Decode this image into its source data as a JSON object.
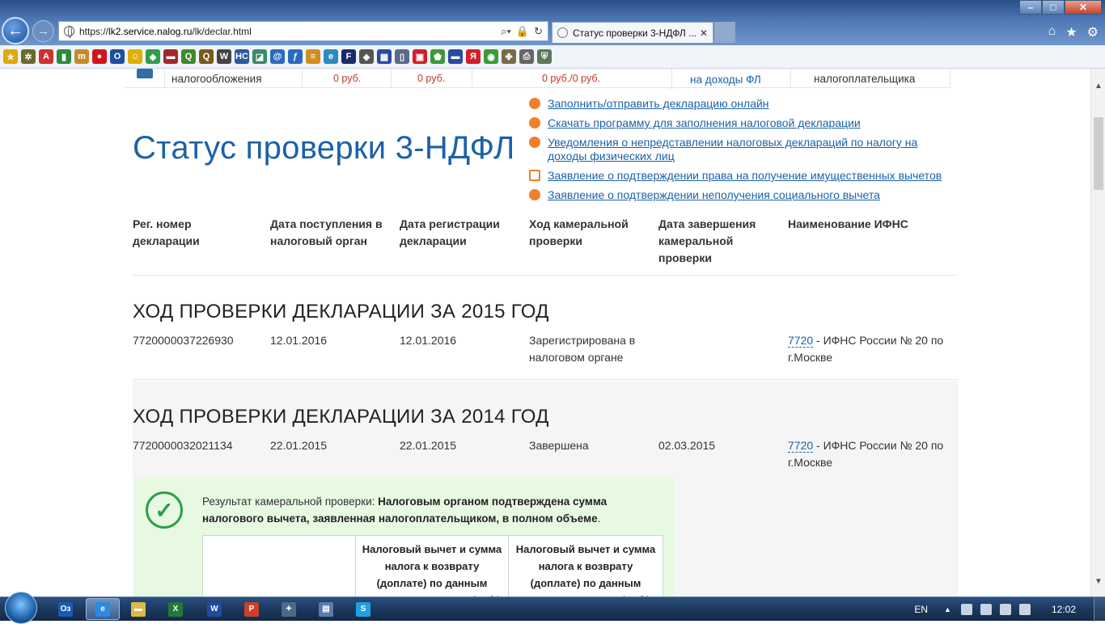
{
  "browser": {
    "url_prefix": "https://",
    "url_host": "lk2.service.nalog.ru",
    "url_path": "/lk/declar.html",
    "tab_title": "Статус проверки 3-НДФЛ ...",
    "search_glyph": "⌕▾",
    "lock_glyph": "🔒",
    "refresh_glyph": "↻",
    "close_tab_glyph": "✕"
  },
  "window_controls": {
    "minimize": "–",
    "maximize": "□",
    "close": "✕"
  },
  "favorites": [
    {
      "icon": "star-add-icon",
      "color": "#e0a800",
      "glyph": "★"
    },
    {
      "icon": "gear-bug-icon",
      "color": "#6a6a2a",
      "glyph": "✲"
    },
    {
      "icon": "letter-a-icon",
      "color": "#d03030",
      "glyph": "A"
    },
    {
      "icon": "green-doc-icon",
      "color": "#2c8a3c",
      "glyph": "▮"
    },
    {
      "icon": "m-icon",
      "color": "#c58b2a",
      "glyph": "m"
    },
    {
      "icon": "opera-icon",
      "color": "#d0151b",
      "glyph": "●"
    },
    {
      "icon": "circle-o-icon",
      "color": "#1c4fa0",
      "glyph": "O"
    },
    {
      "icon": "smile-icon",
      "color": "#e0b000",
      "glyph": "☺"
    },
    {
      "icon": "sber-icon",
      "color": "#2e9e48",
      "glyph": "◆"
    },
    {
      "icon": "flag-icon",
      "color": "#a0282d",
      "glyph": "▬"
    },
    {
      "icon": "q-green-icon",
      "color": "#3e8a2a",
      "glyph": "Q"
    },
    {
      "icon": "q-brown-icon",
      "color": "#7a5a1a",
      "glyph": "Q"
    },
    {
      "icon": "wikipedia-icon",
      "color": "#444444",
      "glyph": "W"
    },
    {
      "icon": "hc-icon",
      "color": "#2c5aa0",
      "glyph": "HC"
    },
    {
      "icon": "chart-icon",
      "color": "#3a8a6a",
      "glyph": "◪"
    },
    {
      "icon": "at-icon",
      "color": "#2c6ac0",
      "glyph": "@"
    },
    {
      "icon": "script-f-icon",
      "color": "#2c6ac0",
      "glyph": "ƒ"
    },
    {
      "icon": "bars-icon",
      "color": "#d09020",
      "glyph": "≡"
    },
    {
      "icon": "ie-page-icon",
      "color": "#2c8ac0",
      "glyph": "e"
    },
    {
      "icon": "f-icon",
      "color": "#1b2a6a",
      "glyph": "F"
    },
    {
      "icon": "diamond-icon",
      "color": "#555555",
      "glyph": "◈"
    },
    {
      "icon": "grid-icon",
      "color": "#2c4aa0",
      "glyph": "▦"
    },
    {
      "icon": "phone-icon",
      "color": "#5a6a8a",
      "glyph": "▯"
    },
    {
      "icon": "red-square-icon",
      "color": "#d0202a",
      "glyph": "▣"
    },
    {
      "icon": "shield-green-icon",
      "color": "#3a9a3a",
      "glyph": "⬟"
    },
    {
      "icon": "russia-flag-icon",
      "color": "#2a4aa0",
      "glyph": "▬"
    },
    {
      "icon": "yandex-icon",
      "color": "#d0202a",
      "glyph": "Я"
    },
    {
      "icon": "green-circle-icon",
      "color": "#3a9a3a",
      "glyph": "◉"
    },
    {
      "icon": "puzzle-icon",
      "color": "#7a6a4a",
      "glyph": "✤"
    },
    {
      "icon": "print-icon",
      "color": "#666666",
      "glyph": "⎙"
    },
    {
      "icon": "shield-icon",
      "color": "#5a7a5a",
      "glyph": "⛨"
    }
  ],
  "top_strip": {
    "cell1": "налогообложения",
    "cell2": "0 руб.",
    "cell3": "0 руб.",
    "cell4": "0 руб./0 руб.",
    "cell5": "на доходы ФЛ",
    "cell6": "налогоплательщика"
  },
  "page": {
    "title": "Статус проверки 3-НДФЛ",
    "links": [
      {
        "label": "Заполнить/отправить декларацию онлайн",
        "color": "#f07f2b"
      },
      {
        "label": "Скачать программу для заполнения налоговой декларации",
        "color": "#f07f2b"
      },
      {
        "label": "Уведомления о непредставлении налоговых деклараций по налогу на доходы физических лиц",
        "color": "#f07f2b"
      },
      {
        "label": "Заявление о подтверждении права на получение имущественных вычетов",
        "color": "#f07f2b"
      },
      {
        "label": "Заявление о подтверждении неполучения социального вычета",
        "color": "#f07f2b"
      }
    ],
    "columns": [
      "Рег. номер декларации",
      "Дата поступления в налоговый орган",
      "Дата регистрации декларации",
      "Ход камеральной проверки",
      "Дата завершения камеральной проверки",
      "Наименование ИФНС"
    ],
    "declarations": [
      {
        "title": "ХОД ПРОВЕРКИ ДЕКЛАРАЦИИ ЗА 2015 ГОД",
        "reg_number": "7720000037226930",
        "received": "12.01.2016",
        "registered": "12.01.2016",
        "status": "Зарегистрирована в налоговом органе",
        "completed": "",
        "ifns_code": "7720",
        "ifns_name": " - ИФНС России № 20 по г.Москве"
      },
      {
        "title": "ХОД ПРОВЕРКИ ДЕКЛАРАЦИИ ЗА 2014 ГОД",
        "reg_number": "7720000032021134",
        "received": "22.01.2015",
        "registered": "22.01.2015",
        "status": "Завершена",
        "completed": "02.03.2015",
        "ifns_code": "7720",
        "ifns_name": " - ИФНС России № 20 по г.Москве"
      }
    ],
    "result": {
      "label": "Результат камеральной проверки: ",
      "text": "Налоговым органом подтверждена сумма налогового вычета, заявленная налогоплательщиком, в полном объеме",
      "table_headers": [
        "",
        "Налоговый вычет и сумма налога к возврату (доплате) по данным налогоплательщика (руб.)",
        "Налоговый вычет и сумма налога к возврату (доплате) по данным налогового органа (руб.)"
      ]
    }
  },
  "taskbar": {
    "buttons": [
      {
        "name": "outlook-taskbar-button",
        "glyph": "O⃣",
        "label": "Oз",
        "color": "#1a5ab0",
        "active": false
      },
      {
        "name": "ie-taskbar-button",
        "glyph": "e",
        "label": "e",
        "color": "#2c8ae0",
        "active": true
      },
      {
        "name": "explorer-taskbar-button",
        "glyph": "▬",
        "label": "▬",
        "color": "#e0b84a",
        "active": false
      },
      {
        "name": "excel-taskbar-button",
        "glyph": "X",
        "label": "X",
        "color": "#1f7a3a",
        "active": false
      },
      {
        "name": "word-taskbar-button",
        "glyph": "W",
        "label": "W",
        "color": "#1f4aa0",
        "active": false
      },
      {
        "name": "powerpoint-taskbar-button",
        "glyph": "P",
        "label": "P",
        "color": "#c8402a",
        "active": false
      },
      {
        "name": "app-taskbar-button",
        "glyph": "✦",
        "label": "✦",
        "color": "#4a6a8a",
        "active": false
      },
      {
        "name": "notes-taskbar-button",
        "glyph": "▤",
        "label": "▤",
        "color": "#5a7ab0",
        "active": false
      },
      {
        "name": "skype-taskbar-button",
        "glyph": "S",
        "label": "S",
        "color": "#1fa0e0",
        "active": false
      }
    ],
    "language": "EN",
    "clock": "12:02"
  }
}
